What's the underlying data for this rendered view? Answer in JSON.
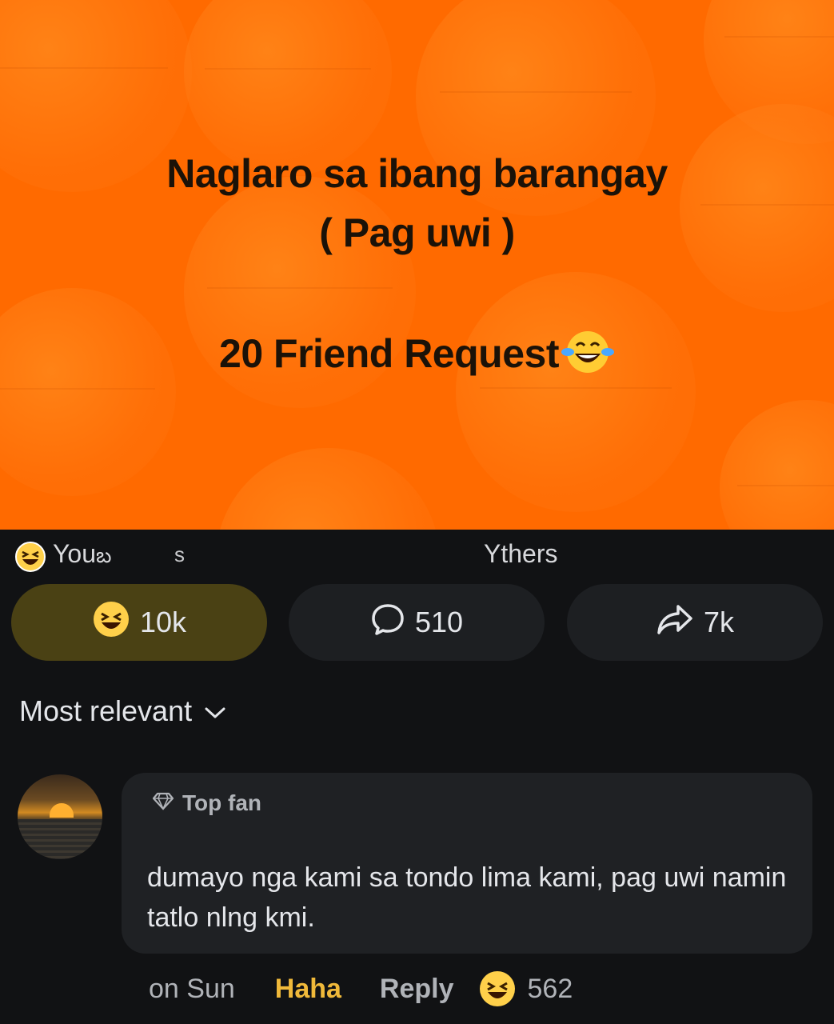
{
  "post": {
    "line1": "Naglaro sa ibang barangay",
    "line2": "( Pag uwi )",
    "line3": "20 Friend Request",
    "line3_emoji": "tears-of-joy-emoji",
    "background_color": "#ff6a00"
  },
  "summary": {
    "reaction_emoji": "haha-emoji",
    "you_text": "You",
    "you_suffix": "బ",
    "middle_text": "s",
    "others_text": "Ythers"
  },
  "actions": {
    "react": {
      "icon": "haha-emoji",
      "count": "10k",
      "active_color": "#4a4114"
    },
    "comment": {
      "icon": "comment-bubble-icon",
      "count": "510"
    },
    "share": {
      "icon": "share-arrow-icon",
      "count": "7k"
    }
  },
  "sort": {
    "label": "Most relevant",
    "icon": "chevron-down-icon"
  },
  "comment": {
    "badge": "Top fan",
    "badge_icon": "diamond-icon",
    "text": "dumayo nga kami sa tondo lima kami, pag uwi namin tatlo nlng kmi.",
    "time": "on Sun",
    "reaction_label": "Haha",
    "reaction_color": "#f0b93a",
    "reply_label": "Reply",
    "reaction_emoji": "haha-emoji",
    "reaction_count": "562"
  }
}
